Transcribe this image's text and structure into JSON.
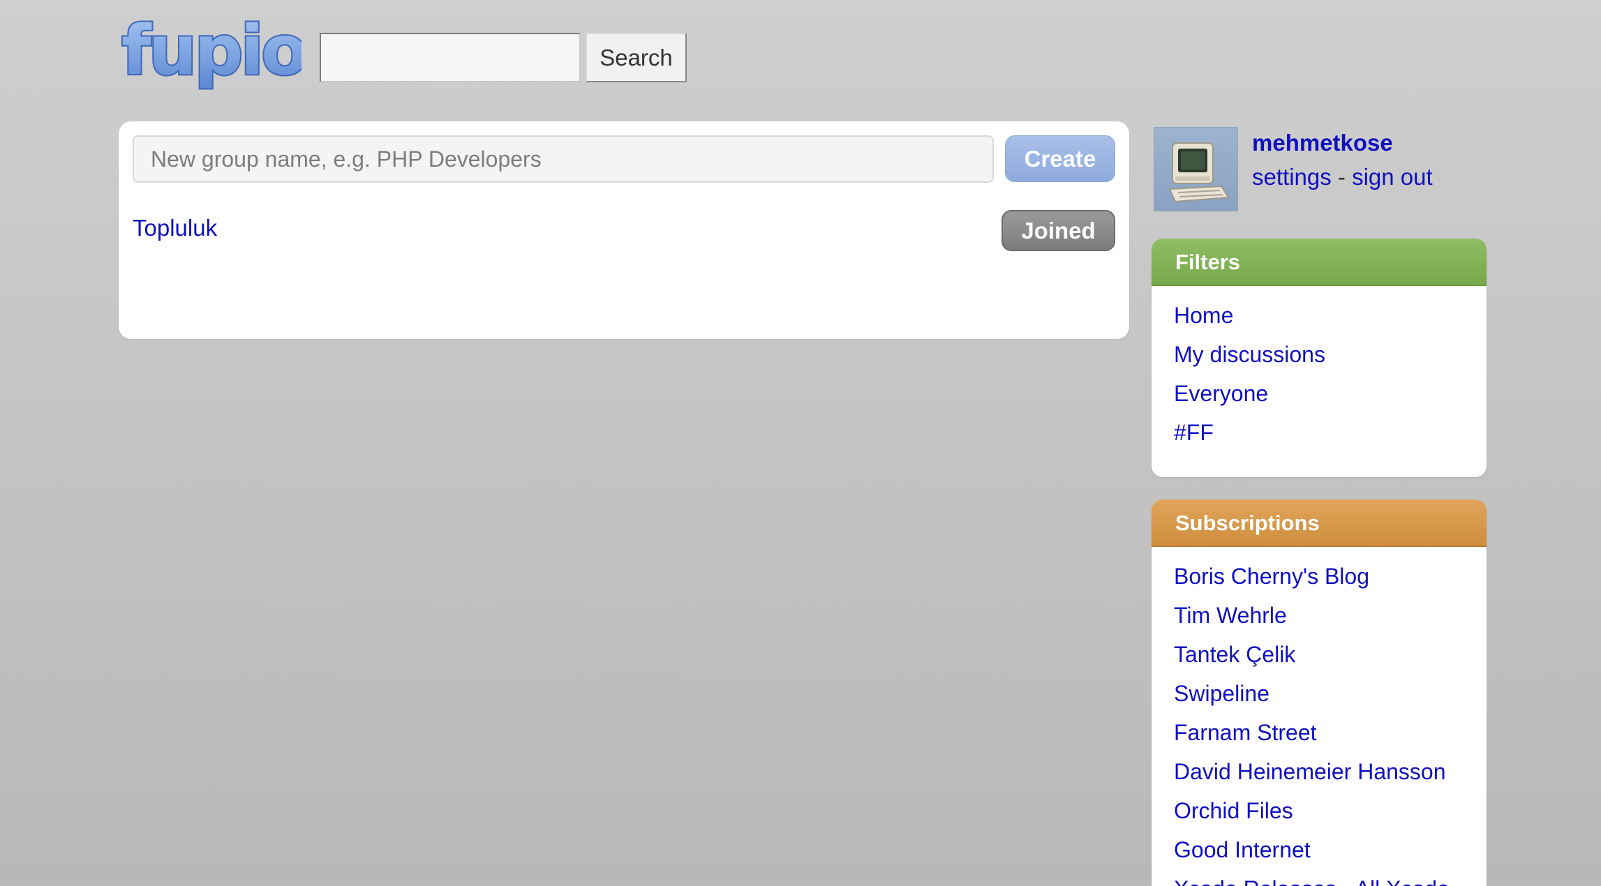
{
  "header": {
    "logo_text": "fupio",
    "search_value": "",
    "search_button_label": "Search"
  },
  "main": {
    "new_group_placeholder": "New group name, e.g. PHP Developers",
    "create_label": "Create",
    "groups": [
      {
        "name": "Topluluk",
        "status_label": "Joined"
      }
    ]
  },
  "user": {
    "username": "mehmetkose",
    "settings_label": "settings",
    "separator": "-",
    "sign_out_label": "sign out"
  },
  "filters": {
    "title": "Filters",
    "items": [
      "Home",
      "My discussions",
      "Everyone",
      "#FF"
    ]
  },
  "subscriptions": {
    "title": "Subscriptions",
    "items": [
      "Boris Cherny's Blog",
      "Tim Wehrle",
      "Tantek Çelik",
      "Swipeline",
      "Farnam Street",
      "David Heinemeier Hansson",
      "Orchid Files",
      "Good Internet",
      "Xcode Releases - All Xcode"
    ]
  },
  "colors": {
    "link": "#1010c0",
    "filters_header": "#82b356",
    "subscriptions_header": "#d6994a",
    "create_button": "#99b4e2",
    "joined_button": "#8a8a8a"
  }
}
